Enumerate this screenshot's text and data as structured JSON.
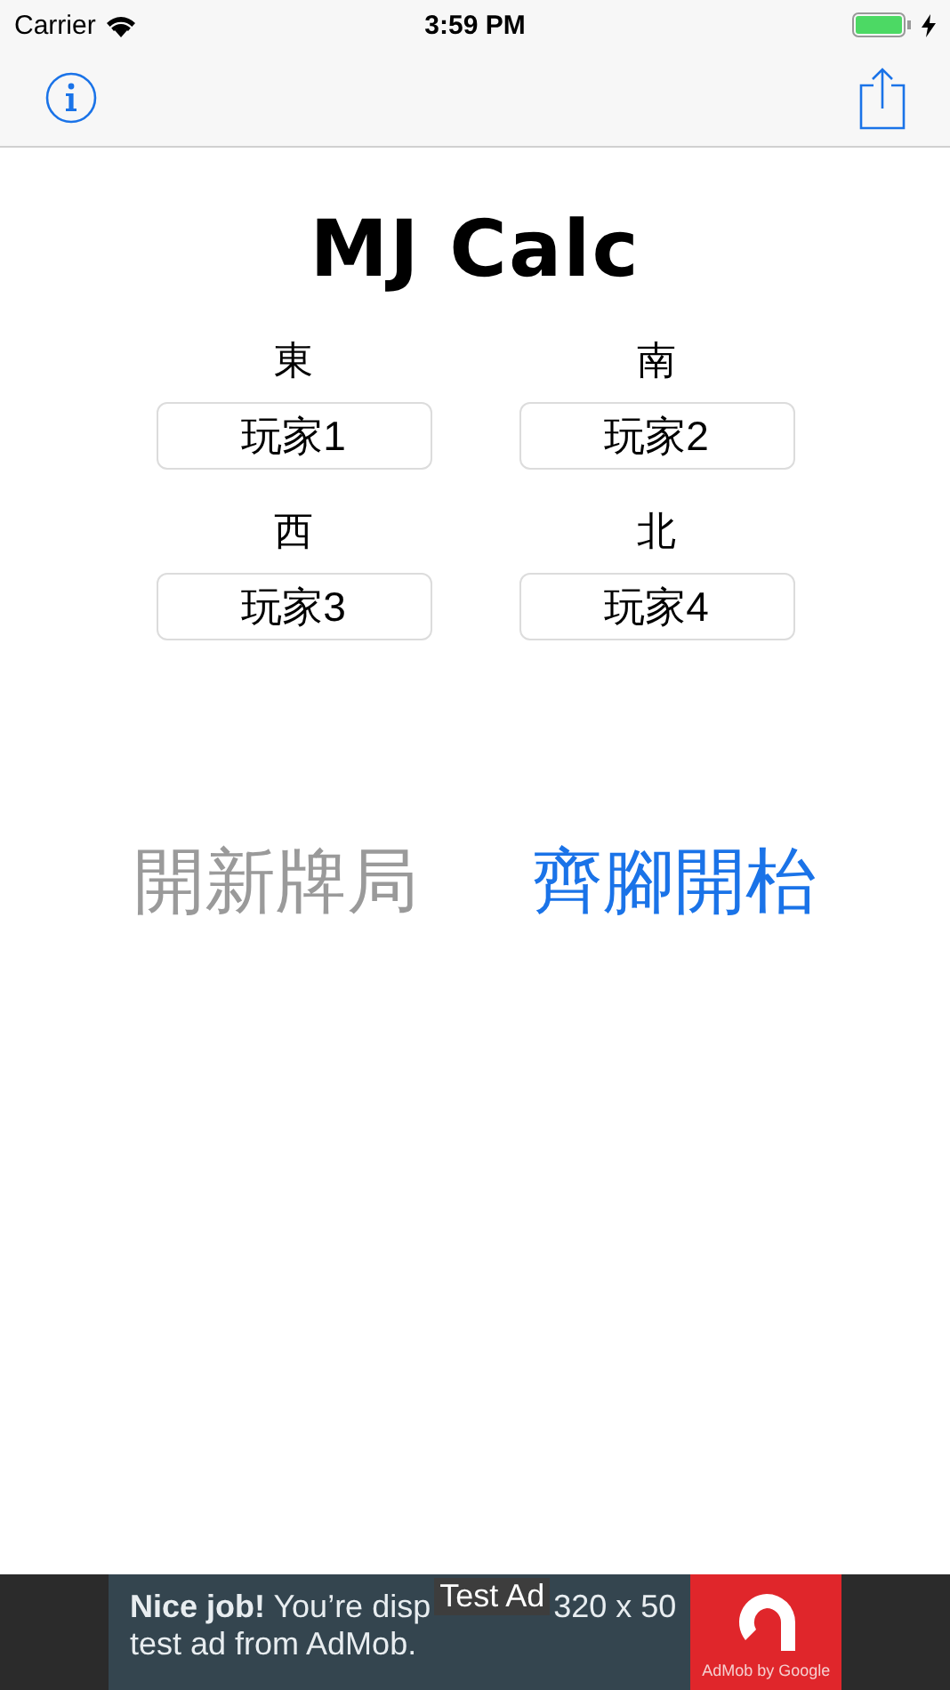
{
  "status_bar": {
    "carrier": "Carrier",
    "time": "3:59 PM"
  },
  "title": "MJ Calc",
  "players": [
    {
      "wind": "東",
      "value": "玩家1"
    },
    {
      "wind": "南",
      "value": "玩家2"
    },
    {
      "wind": "西",
      "value": "玩家3"
    },
    {
      "wind": "北",
      "value": "玩家4"
    }
  ],
  "actions": [
    {
      "label": "開新牌局",
      "disabled": true
    },
    {
      "label": "齊腳開枱",
      "disabled": false
    }
  ],
  "ad": {
    "line1_start": "**Nice job!** You’re disp",
    "badge": "Test Ad",
    "line1_end": "320 x 50",
    "line2": "test ad from AdMob.",
    "logo_caption": "AdMob by Google"
  }
}
